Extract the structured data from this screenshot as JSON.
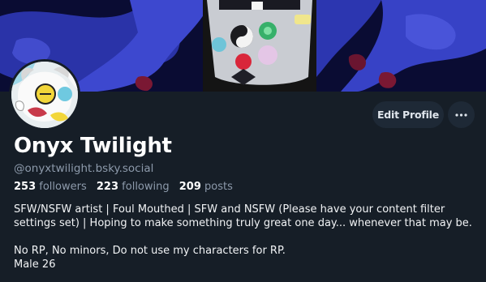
{
  "profile": {
    "display_name": "Onyx Twilight",
    "handle": "@onyxtwilight.bsky.social"
  },
  "stats": {
    "followers_count": "253",
    "followers_label": "followers",
    "following_count": "223",
    "following_label": "following",
    "posts_count": "209",
    "posts_label": "posts"
  },
  "bio": {
    "line1": "SFW/NSFW artist | Foul Mouthed | SFW and NSFW (Please have your content filter",
    "line2": "settings set) | Hoping to make something truly great one day... whenever that may be.",
    "line3": "No RP, No minors, Do not use my characters for RP.",
    "line4": "Male 26"
  },
  "actions": {
    "edit_profile_label": "Edit Profile",
    "more_icon": "ellipsis-icon"
  },
  "colors": {
    "background": "#161e27",
    "button_background": "#1e2936",
    "muted_text": "#8d9aab",
    "banner_blue": "#2f3ab4"
  }
}
